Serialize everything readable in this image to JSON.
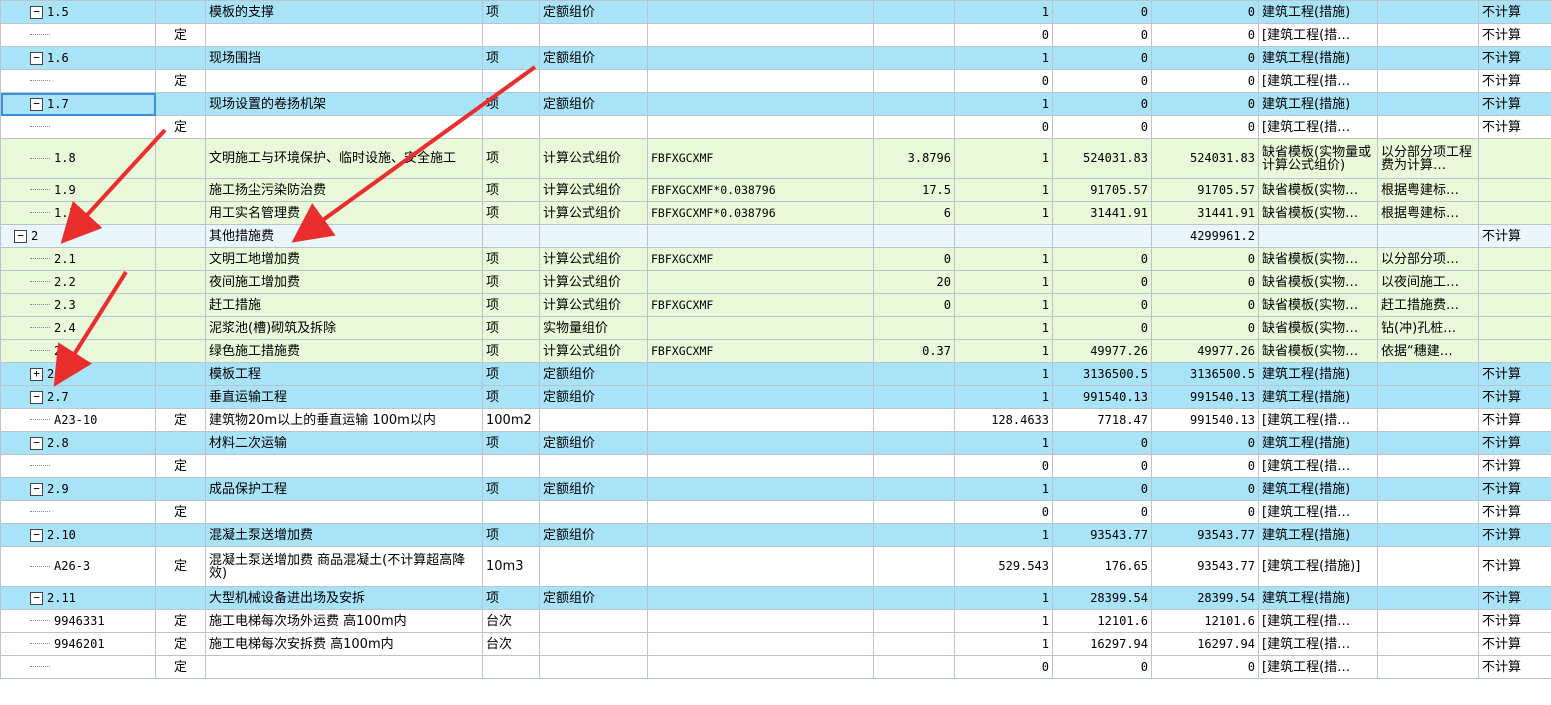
{
  "colors": {
    "section_row": "#a9e3f7",
    "calc_row": "#e9f8d8",
    "group_row": "#e9f6fb",
    "arrow": "#ea2d2d"
  },
  "rows": [
    {
      "kind": "sect",
      "toggle": "minus",
      "code": "1.5",
      "type": "",
      "name": "模板的支撑",
      "unit": "项",
      "method": "定额组价",
      "formula": "",
      "rate": "",
      "qty": "1",
      "price": "0",
      "total": "0",
      "template": "建筑工程(措施)",
      "base": "",
      "flag": "不计算"
    },
    {
      "kind": "sub",
      "toggle": "",
      "code": "",
      "type": "定",
      "name": "",
      "unit": "",
      "method": "",
      "formula": "",
      "rate": "",
      "qty": "0",
      "price": "0",
      "total": "0",
      "template": "[建筑工程(措…",
      "base": "",
      "flag": "不计算"
    },
    {
      "kind": "sect",
      "toggle": "minus",
      "code": "1.6",
      "type": "",
      "name": "现场围挡",
      "unit": "项",
      "method": "定额组价",
      "formula": "",
      "rate": "",
      "qty": "1",
      "price": "0",
      "total": "0",
      "template": "建筑工程(措施)",
      "base": "",
      "flag": "不计算"
    },
    {
      "kind": "sub",
      "toggle": "",
      "code": "",
      "type": "定",
      "name": "",
      "unit": "",
      "method": "",
      "formula": "",
      "rate": "",
      "qty": "0",
      "price": "0",
      "total": "0",
      "template": "[建筑工程(措…",
      "base": "",
      "flag": "不计算"
    },
    {
      "kind": "sect",
      "toggle": "minus",
      "code": "1.7",
      "type": "",
      "name": "现场设置的卷扬机架",
      "unit": "项",
      "method": "定额组价",
      "formula": "",
      "rate": "",
      "qty": "1",
      "price": "0",
      "total": "0",
      "template": "建筑工程(措施)",
      "base": "",
      "flag": "不计算",
      "selected": true
    },
    {
      "kind": "sub",
      "toggle": "",
      "code": "",
      "type": "定",
      "name": "",
      "unit": "",
      "method": "",
      "formula": "",
      "rate": "",
      "qty": "0",
      "price": "0",
      "total": "0",
      "template": "[建筑工程(措…",
      "base": "",
      "flag": "不计算"
    },
    {
      "kind": "calc",
      "tall": true,
      "toggle": "",
      "code": "1.8",
      "type": "",
      "name": "文明施工与环境保护、临时设施、安全施工",
      "unit": "项",
      "method": "计算公式组价",
      "formula": "FBFXGCXMF",
      "rate": "3.8796",
      "qty": "1",
      "price": "524031.83",
      "total": "524031.83",
      "template": "缺省模板(实物量或计算公式组价)",
      "base": "以分部分项工程费为计算…",
      "flag": ""
    },
    {
      "kind": "calc",
      "toggle": "",
      "code": "1.9",
      "type": "",
      "name": "施工扬尘污染防治费",
      "unit": "项",
      "method": "计算公式组价",
      "formula": "FBFXGCXMF*0.038796",
      "rate": "17.5",
      "qty": "1",
      "price": "91705.57",
      "total": "91705.57",
      "template": "缺省模板(实物…",
      "base": "根据粤建标…",
      "flag": ""
    },
    {
      "kind": "calc",
      "toggle": "",
      "code": "1.10",
      "type": "",
      "name": "用工实名管理费",
      "unit": "项",
      "method": "计算公式组价",
      "formula": "FBFXGCXMF*0.038796",
      "rate": "6",
      "qty": "1",
      "price": "31441.91",
      "total": "31441.91",
      "template": "缺省模板(实物…",
      "base": "根据粤建标…",
      "flag": ""
    },
    {
      "kind": "grp",
      "toggle": "minus",
      "code": "2",
      "type": "",
      "name": "其他措施费",
      "unit": "",
      "method": "",
      "formula": "",
      "rate": "",
      "qty": "",
      "price": "",
      "total": "4299961.2",
      "template": "",
      "base": "",
      "flag": "不计算"
    },
    {
      "kind": "calc",
      "toggle": "",
      "code": "2.1",
      "type": "",
      "name": "文明工地增加费",
      "unit": "项",
      "method": "计算公式组价",
      "formula": "FBFXGCXMF",
      "rate": "0",
      "qty": "1",
      "price": "0",
      "total": "0",
      "template": "缺省模板(实物…",
      "base": "以分部分项…",
      "flag": ""
    },
    {
      "kind": "calc",
      "toggle": "",
      "code": "2.2",
      "type": "",
      "name": "夜间施工增加费",
      "unit": "项",
      "method": "计算公式组价",
      "formula": "",
      "rate": "20",
      "qty": "1",
      "price": "0",
      "total": "0",
      "template": "缺省模板(实物…",
      "base": "以夜间施工…",
      "flag": ""
    },
    {
      "kind": "calc",
      "toggle": "",
      "code": "2.3",
      "type": "",
      "name": "赶工措施",
      "unit": "项",
      "method": "计算公式组价",
      "formula": "FBFXGCXMF",
      "rate": "0",
      "qty": "1",
      "price": "0",
      "total": "0",
      "template": "缺省模板(实物…",
      "base": "赶工措施费…",
      "flag": ""
    },
    {
      "kind": "calc",
      "toggle": "",
      "code": "2.4",
      "type": "",
      "name": "泥浆池(槽)砌筑及拆除",
      "unit": "项",
      "method": "实物量组价",
      "formula": "",
      "rate": "",
      "qty": "1",
      "price": "0",
      "total": "0",
      "template": "缺省模板(实物…",
      "base": "钻(冲)孔桩…",
      "flag": ""
    },
    {
      "kind": "calc",
      "toggle": "",
      "code": "2.",
      "type": "",
      "name": "绿色施工措施费",
      "unit": "项",
      "method": "计算公式组价",
      "formula": "FBFXGCXMF",
      "rate": "0.37",
      "qty": "1",
      "price": "49977.26",
      "total": "49977.26",
      "template": "缺省模板(实物…",
      "base": "依据“穗建…",
      "flag": ""
    },
    {
      "kind": "sect",
      "toggle": "plus",
      "code": "2.6",
      "type": "",
      "name": "模板工程",
      "unit": "项",
      "method": "定额组价",
      "formula": "",
      "rate": "",
      "qty": "1",
      "price": "3136500.5",
      "total": "3136500.5",
      "template": "建筑工程(措施)",
      "base": "",
      "flag": "不计算"
    },
    {
      "kind": "sect",
      "toggle": "minus",
      "code": "2.7",
      "type": "",
      "name": "垂直运输工程",
      "unit": "项",
      "method": "定额组价",
      "formula": "",
      "rate": "",
      "qty": "1",
      "price": "991540.13",
      "total": "991540.13",
      "template": "建筑工程(措施)",
      "base": "",
      "flag": "不计算"
    },
    {
      "kind": "sub",
      "toggle": "",
      "code": "A23-10",
      "type": "定",
      "name": "建筑物20m以上的垂直运输 100m以内",
      "unit": "100m2",
      "method": "",
      "formula": "",
      "rate": "",
      "qty": "128.4633",
      "price": "7718.47",
      "total": "991540.13",
      "template": "[建筑工程(措…",
      "base": "",
      "flag": "不计算"
    },
    {
      "kind": "sect",
      "toggle": "minus",
      "code": "2.8",
      "type": "",
      "name": "材料二次运输",
      "unit": "项",
      "method": "定额组价",
      "formula": "",
      "rate": "",
      "qty": "1",
      "price": "0",
      "total": "0",
      "template": "建筑工程(措施)",
      "base": "",
      "flag": "不计算"
    },
    {
      "kind": "sub",
      "toggle": "",
      "code": "",
      "type": "定",
      "name": "",
      "unit": "",
      "method": "",
      "formula": "",
      "rate": "",
      "qty": "0",
      "price": "0",
      "total": "0",
      "template": "[建筑工程(措…",
      "base": "",
      "flag": "不计算"
    },
    {
      "kind": "sect",
      "toggle": "minus",
      "code": "2.9",
      "type": "",
      "name": "成品保护工程",
      "unit": "项",
      "method": "定额组价",
      "formula": "",
      "rate": "",
      "qty": "1",
      "price": "0",
      "total": "0",
      "template": "建筑工程(措施)",
      "base": "",
      "flag": "不计算"
    },
    {
      "kind": "sub",
      "toggle": "",
      "code": "",
      "type": "定",
      "name": "",
      "unit": "",
      "method": "",
      "formula": "",
      "rate": "",
      "qty": "0",
      "price": "0",
      "total": "0",
      "template": "[建筑工程(措…",
      "base": "",
      "flag": "不计算"
    },
    {
      "kind": "sect",
      "toggle": "minus",
      "code": "2.10",
      "type": "",
      "name": "混凝土泵送增加费",
      "unit": "项",
      "method": "定额组价",
      "formula": "",
      "rate": "",
      "qty": "1",
      "price": "93543.77",
      "total": "93543.77",
      "template": "建筑工程(措施)",
      "base": "",
      "flag": "不计算"
    },
    {
      "kind": "sub",
      "tall": true,
      "toggle": "",
      "code": "A26-3",
      "type": "定",
      "name": "混凝土泵送增加费 商品混凝土(不计算超高降效)",
      "unit": "10m3",
      "method": "",
      "formula": "",
      "rate": "",
      "qty": "529.543",
      "price": "176.65",
      "total": "93543.77",
      "template": "[建筑工程(措施)]",
      "base": "",
      "flag": "不计算"
    },
    {
      "kind": "sect",
      "toggle": "minus",
      "code": "2.11",
      "type": "",
      "name": "大型机械设备进出场及安拆",
      "unit": "项",
      "method": "定额组价",
      "formula": "",
      "rate": "",
      "qty": "1",
      "price": "28399.54",
      "total": "28399.54",
      "template": "建筑工程(措施)",
      "base": "",
      "flag": "不计算"
    },
    {
      "kind": "sub",
      "toggle": "",
      "code": "9946331",
      "type": "定",
      "name": "施工电梯每次场外运费 高100m内",
      "unit": "台次",
      "method": "",
      "formula": "",
      "rate": "",
      "qty": "1",
      "price": "12101.6",
      "total": "12101.6",
      "template": "[建筑工程(措…",
      "base": "",
      "flag": "不计算"
    },
    {
      "kind": "sub",
      "toggle": "",
      "code": "9946201",
      "type": "定",
      "name": "施工电梯每次安拆费 高100m内",
      "unit": "台次",
      "method": "",
      "formula": "",
      "rate": "",
      "qty": "1",
      "price": "16297.94",
      "total": "16297.94",
      "template": "[建筑工程(措…",
      "base": "",
      "flag": "不计算"
    },
    {
      "kind": "sub",
      "toggle": "",
      "code": "",
      "type": "定",
      "name": "",
      "unit": "",
      "method": "",
      "formula": "",
      "rate": "",
      "qty": "0",
      "price": "0",
      "total": "0",
      "template": "[建筑工程(措…",
      "base": "",
      "flag": "不计算"
    }
  ]
}
